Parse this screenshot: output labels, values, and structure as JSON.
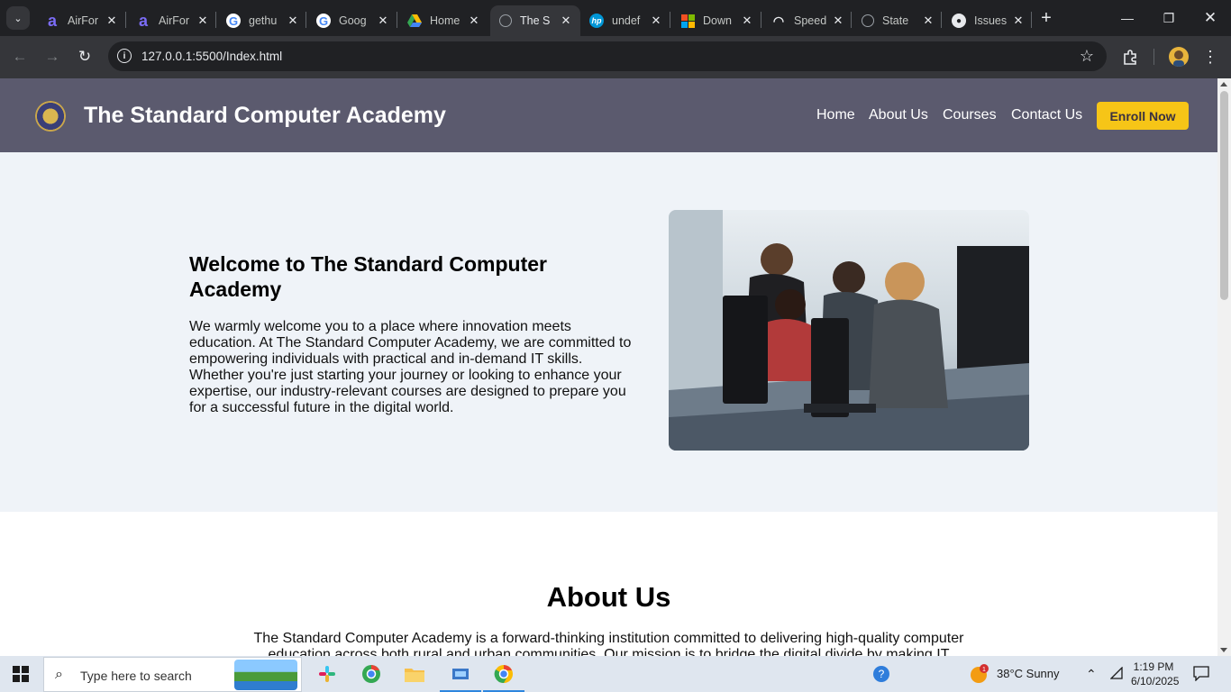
{
  "browser": {
    "tabs": [
      {
        "title": "AirFor",
        "icon": "airform-icon",
        "color": "#6f5ff5"
      },
      {
        "title": "AirFor",
        "icon": "airform-icon",
        "color": "#6f5ff5"
      },
      {
        "title": "gethu",
        "icon": "google-icon",
        "color": "#4285f4"
      },
      {
        "title": "Goog",
        "icon": "google-icon",
        "color": "#4285f4"
      },
      {
        "title": "Home",
        "icon": "google-drive-icon",
        "color": "#34a853"
      },
      {
        "title": "The S",
        "icon": "globe-icon",
        "color": "#9aa0a6"
      },
      {
        "title": "undef",
        "icon": "hp-icon",
        "color": "#0096d6"
      },
      {
        "title": "Down",
        "icon": "microsoft-icon",
        "color": "#f25022"
      },
      {
        "title": "Speed",
        "icon": "speedtest-icon",
        "color": "#e8eaed"
      },
      {
        "title": "State",
        "icon": "globe-icon",
        "color": "#9aa0a6"
      },
      {
        "title": "Issues",
        "icon": "github-icon",
        "color": "#e8eaed"
      }
    ],
    "url": "127.0.0.1:5500/Index.html"
  },
  "site": {
    "title": "The Standard Computer Academy",
    "nav": {
      "home": "Home",
      "about": "About Us",
      "courses": "Courses",
      "contact": "Contact Us",
      "enroll": "Enroll Now"
    },
    "hero": {
      "title": "Welcome to The Standard Computer Academy",
      "text": "We warmly welcome you to a place where innovation meets education. At The Standard Computer Academy, we are committed to empowering individuals with practical and in-demand IT skills. Whether you're just starting your journey or looking to enhance your expertise, our industry-relevant courses are designed to prepare you for a successful future in the digital world."
    },
    "about": {
      "title": "About Us",
      "text": "The Standard Computer Academy is a forward-thinking institution committed to delivering high-quality computer education across both rural and urban communities. Our mission is to bridge the digital divide by making IT"
    },
    "colors": {
      "header": "#5b5a6e",
      "hero": "#eff3f8",
      "accent": "#f6c517"
    }
  },
  "taskbar": {
    "search_placeholder": "Type here to search",
    "weather": "38°C  Sunny",
    "weather_badge": "1",
    "time": "1:19 PM",
    "date": "6/10/2025"
  }
}
